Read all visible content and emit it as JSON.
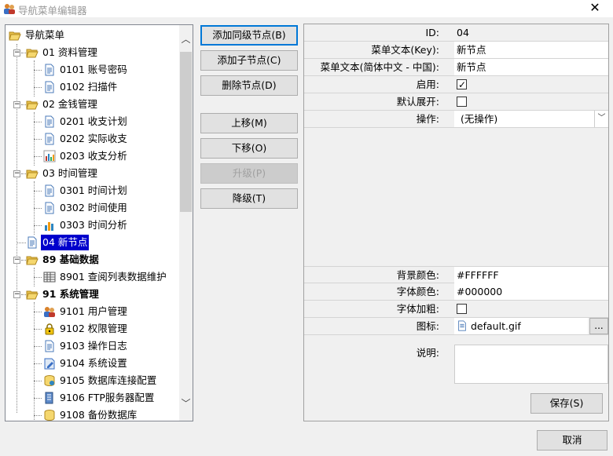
{
  "window": {
    "title": "导航菜单编辑器",
    "close_label": "✕"
  },
  "tree": {
    "root": "导航菜单",
    "nodes": [
      {
        "label": "01 资料管理"
      },
      {
        "label": "0101 账号密码"
      },
      {
        "label": "0102 扫描件"
      },
      {
        "label": "02 金钱管理"
      },
      {
        "label": "0201 收支计划"
      },
      {
        "label": "0202 实际收支"
      },
      {
        "label": "0203 收支分析"
      },
      {
        "label": "03 时间管理"
      },
      {
        "label": "0301 时间计划"
      },
      {
        "label": "0302 时间使用"
      },
      {
        "label": "0303 时间分析"
      },
      {
        "label": "04 新节点"
      },
      {
        "label": "89 基础数据"
      },
      {
        "label": "8901 查阅列表数据维护"
      },
      {
        "label": "91 系统管理"
      },
      {
        "label": "9101 用户管理"
      },
      {
        "label": "9102 权限管理"
      },
      {
        "label": "9103 操作日志"
      },
      {
        "label": "9104 系统设置"
      },
      {
        "label": "9105 数据库连接配置"
      },
      {
        "label": "9106 FTP服务器配置"
      },
      {
        "label": "9108 备份数据库"
      }
    ]
  },
  "actions": {
    "add_sibling": "添加同级节点(B)",
    "add_child": "添加子节点(C)",
    "delete": "删除节点(D)",
    "move_up": "上移(M)",
    "move_down": "下移(O)",
    "promote": "升级(P)",
    "demote": "降级(T)"
  },
  "props": {
    "id_label": "ID:",
    "id_value": "04",
    "key_label": "菜单文本(Key):",
    "key_value": "新节点",
    "zh_label": "菜单文本(简体中文 - 中国):",
    "zh_value": "新节点",
    "enabled_label": "启用:",
    "enabled_checked": "✓",
    "expand_label": "默认展开:",
    "op_label": "操作:",
    "op_value": "(无操作)",
    "bg_label": "背景颜色:",
    "bg_value": "#FFFFFF",
    "font_color_label": "字体颜色:",
    "font_color_value": "#000000",
    "bold_label": "字体加粗:",
    "icon_label": "图标:",
    "icon_value": "default.gif",
    "icon_button": "...",
    "desc_label": "说明:"
  },
  "buttons": {
    "save": "保存(S)",
    "cancel": "取消"
  }
}
